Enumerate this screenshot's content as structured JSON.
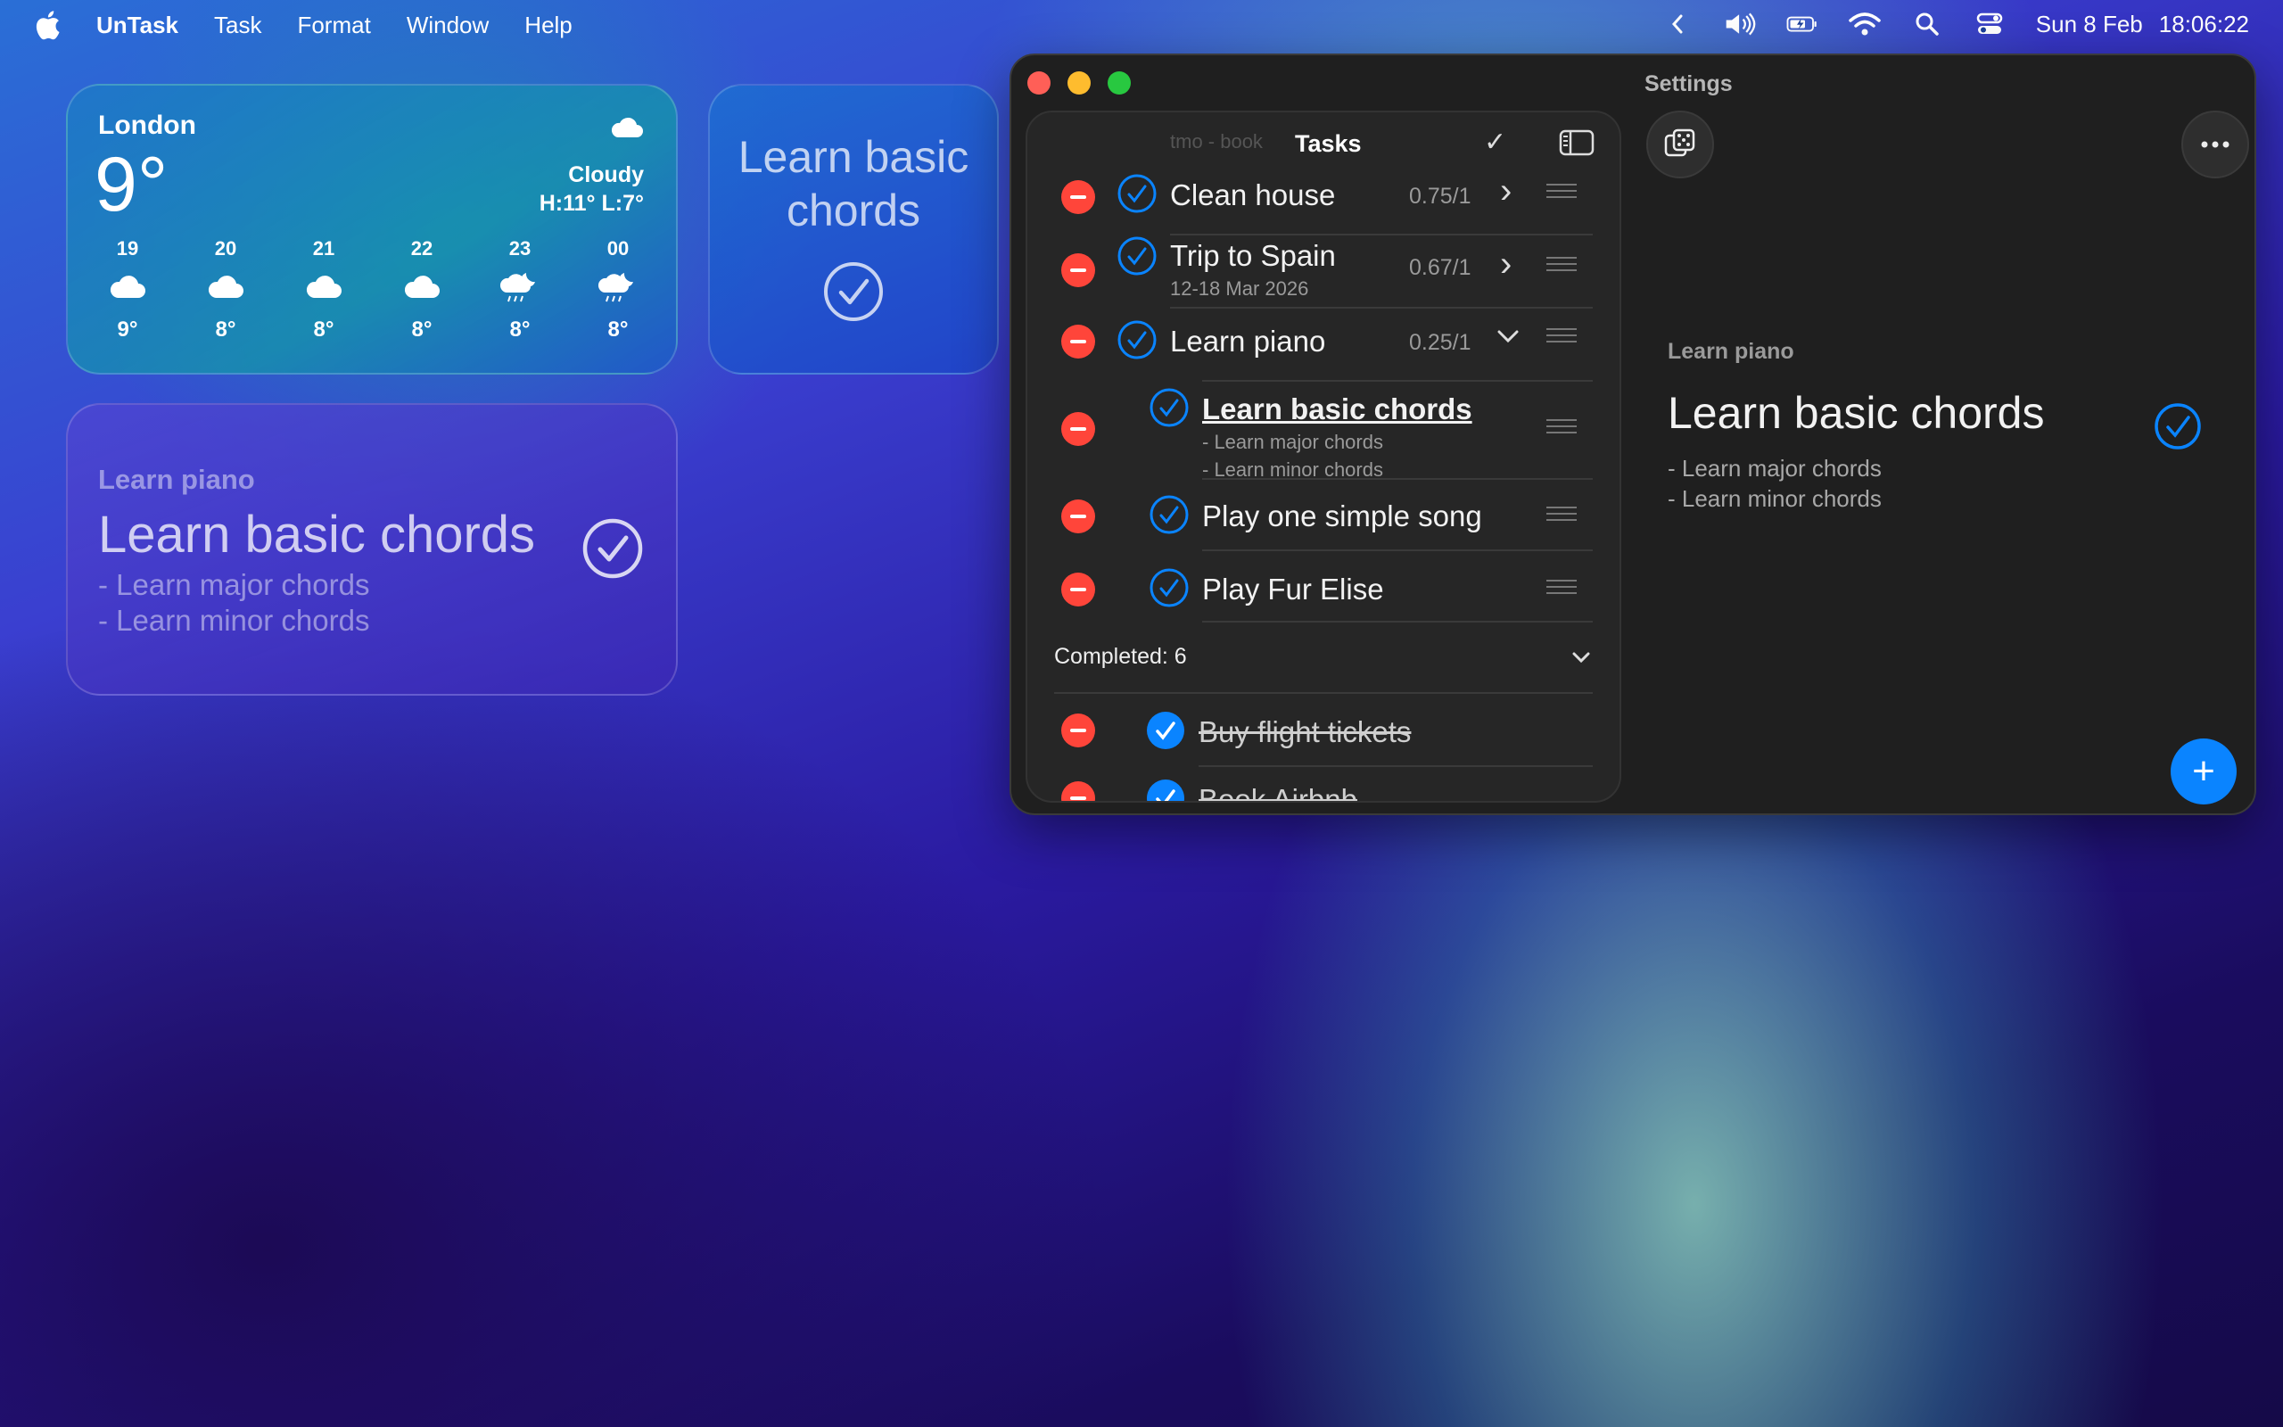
{
  "menubar": {
    "app_name": "UnTask",
    "menus": [
      "Task",
      "Format",
      "Window",
      "Help"
    ],
    "date": "Sun 8 Feb",
    "time": "18:06:22"
  },
  "weather_widget": {
    "city": "London",
    "temperature": "9°",
    "condition": "Cloudy",
    "hi_lo": "H:11° L:7°",
    "hours": [
      {
        "label": "19",
        "temp": "9°",
        "icon": "cloud-icon"
      },
      {
        "label": "20",
        "temp": "8°",
        "icon": "cloud-icon"
      },
      {
        "label": "21",
        "temp": "8°",
        "icon": "cloud-icon"
      },
      {
        "label": "22",
        "temp": "8°",
        "icon": "cloud-icon"
      },
      {
        "label": "23",
        "temp": "8°",
        "icon": "cloud-moon-rain-icon"
      },
      {
        "label": "00",
        "temp": "8°",
        "icon": "cloud-moon-rain-icon"
      }
    ]
  },
  "small_widget": {
    "title": "Learn basic chords"
  },
  "medium_widget": {
    "parent": "Learn piano",
    "title": "Learn basic chords",
    "notes": [
      "- Learn major chords",
      "- Learn minor chords"
    ]
  },
  "window": {
    "sidebar_title": "Tasks",
    "sidebar_ghost": "tmo - book",
    "tasks": [
      {
        "title": "Clean house",
        "progress": "0.75/1",
        "chevron": "›"
      },
      {
        "title": "Trip to Spain",
        "subtitle": "12-18 Mar 2026",
        "progress": "0.67/1",
        "chevron": "›"
      },
      {
        "title": "Learn piano",
        "progress": "0.25/1",
        "chevron": "⌄"
      }
    ],
    "subtasks": [
      {
        "title": "Learn basic chords",
        "notes": [
          "- Learn major chords",
          "- Learn minor chords"
        ]
      },
      {
        "title": "Play one simple song"
      },
      {
        "title": "Play Fur Elise"
      }
    ],
    "completed_label": "Completed: 6",
    "completed_tasks": [
      {
        "title": "Buy flight tickets"
      },
      {
        "title": "Book Airbnb"
      }
    ],
    "detail": {
      "header": "Settings",
      "parent": "Learn piano",
      "title": "Learn basic chords",
      "notes": [
        "- Learn major chords",
        "- Learn minor chords"
      ],
      "add_label": "+"
    }
  },
  "colors": {
    "accent": "#0a84ff",
    "delete": "#ff453a",
    "window_bg": "#1f1f1f"
  }
}
